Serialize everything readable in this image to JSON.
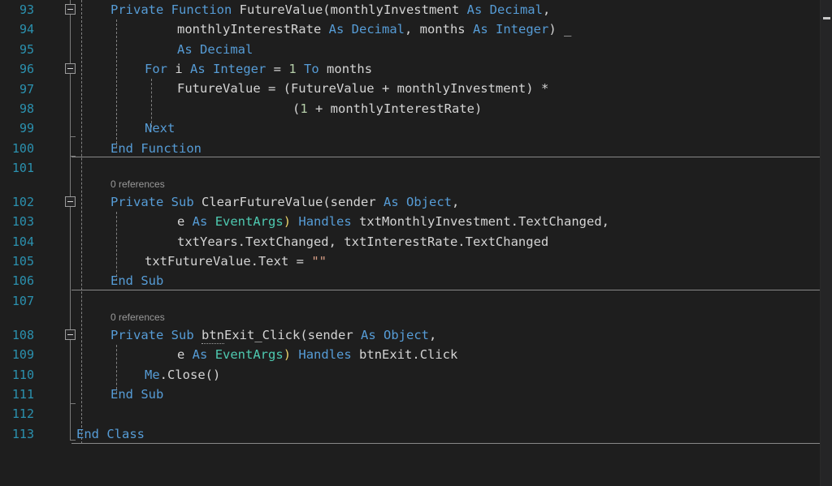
{
  "editor": {
    "language": "Visual Basic",
    "theme": "dark",
    "background_color": "#1E1E1E",
    "line_number_color": "#2B91AF",
    "keyword_color": "#569CD6",
    "type_color": "#4EC9B0",
    "string_color": "#D69D85",
    "number_color": "#B5CEA8",
    "text_color": "#D4D4D4",
    "bracket_gold_color": "#E8D36A",
    "codelens_color": "#999999",
    "outline_color": "#7A7A7A",
    "first_visible_line": "93",
    "last_visible_line": "113"
  },
  "line_numbers": [
    "93",
    "94",
    "95",
    "96",
    "97",
    "98",
    "99",
    "100",
    "101",
    "102",
    "103",
    "104",
    "105",
    "106",
    "107",
    "108",
    "109",
    "110",
    "111",
    "112",
    "113"
  ],
  "codelens": [
    {
      "id": "clearfuturevalue",
      "label": "0 references"
    },
    {
      "id": "btnexit_click",
      "label": "0 references"
    }
  ],
  "code": {
    "l93": {
      "a": "Private",
      "b": " ",
      "c": "Function",
      "d": " FutureValue(monthlyInvestment ",
      "e": "As",
      "f": " ",
      "g": "Decimal",
      "h": ","
    },
    "l94": {
      "a": "monthlyInterestRate ",
      "b": "As",
      "c": " ",
      "d": "Decimal",
      "e": ", months ",
      "f": "As",
      "g": " ",
      "h": "Integer",
      "i": ")",
      "j": " _"
    },
    "l95": {
      "a": "As",
      "b": " ",
      "c": "Decimal"
    },
    "l96": {
      "a": "For",
      "b": " i ",
      "c": "As",
      "d": " ",
      "e": "Integer",
      "f": " = ",
      "g": "1",
      "h": " ",
      "i": "To",
      "j": " months"
    },
    "l97": {
      "a": "FutureValue = (FutureValue + monthlyInvestment)",
      "b": " *"
    },
    "l98": {
      "a": "(",
      "b": "1",
      "c": " + monthlyInterestRate)"
    },
    "l99": {
      "a": "Next"
    },
    "l100": {
      "a": "End",
      "b": " ",
      "c": "Function"
    },
    "l102": {
      "a": "Private",
      "b": " ",
      "c": "Sub",
      "d": " ",
      "e": "ClearFutureValue",
      "f": "(sender ",
      "g": "As",
      "h": " ",
      "i": "Object",
      "j": ","
    },
    "l103": {
      "a": "e ",
      "b": "As",
      "c": " ",
      "d": "EventArgs",
      "e": ")",
      "f": " ",
      "g": "Handles",
      "h": " txtMonthlyInvestment.TextChanged,"
    },
    "l104": {
      "a": "txtYears.TextChanged, txtInterestRate.TextChanged"
    },
    "l105": {
      "a": "txtFutureValue.Text = ",
      "b": "\"\""
    },
    "l106": {
      "a": "End",
      "b": " ",
      "c": "Sub"
    },
    "l108": {
      "a": "Private",
      "b": " ",
      "c": "Sub",
      "d": " ",
      "e": "btn",
      "f": "Exit_Click",
      "g": "(sender ",
      "h": "As",
      "i": " ",
      "j": "Object",
      "k": ","
    },
    "l109": {
      "a": "e ",
      "b": "As",
      "c": " ",
      "d": "EventArgs",
      "e": ")",
      "f": " ",
      "g": "Handles",
      "h": " btnExit.Click"
    },
    "l110": {
      "a": "Me",
      "b": ".Close()"
    },
    "l111": {
      "a": "End",
      "b": " ",
      "c": "Sub"
    },
    "l113": {
      "a": "End",
      "b": " ",
      "c": "Class"
    }
  }
}
